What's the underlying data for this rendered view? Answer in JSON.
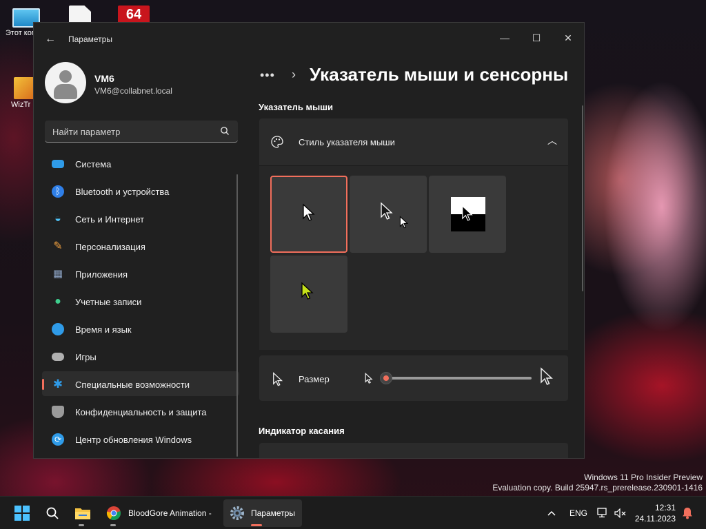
{
  "desktop": {
    "icons": [
      {
        "label": "Этот компьютер"
      },
      {
        "label": ""
      },
      {
        "label": ""
      },
      {
        "label": "WizTr"
      }
    ],
    "watermark": {
      "line1": "Windows 11 Pro Insider Preview",
      "line2": "Evaluation copy. Build 25947.rs_prerelease.230901-1416"
    }
  },
  "window": {
    "title": "Параметры",
    "controls": {
      "minimize": "—",
      "maximize": "☐",
      "close": "✕"
    }
  },
  "profile": {
    "name": "VM6",
    "email": "VM6@collabnet.local"
  },
  "search": {
    "placeholder": "Найти параметр"
  },
  "sidebar": {
    "items": [
      {
        "label": "Система",
        "icon": "system-icon",
        "color": "#2f9be8"
      },
      {
        "label": "Bluetooth и устройства",
        "icon": "bluetooth-icon",
        "color": "#2f7fe8"
      },
      {
        "label": "Сеть и Интернет",
        "icon": "wifi-icon",
        "color": "#4fc3f7"
      },
      {
        "label": "Персонализация",
        "icon": "brush-icon",
        "color": "#f0a040"
      },
      {
        "label": "Приложения",
        "icon": "apps-icon",
        "color": "#8aa0c0"
      },
      {
        "label": "Учетные записи",
        "icon": "account-icon",
        "color": "#3ecf8e"
      },
      {
        "label": "Время и язык",
        "icon": "globe-clock-icon",
        "color": "#2f9be8"
      },
      {
        "label": "Игры",
        "icon": "gamepad-icon",
        "color": "#b0b0b0"
      },
      {
        "label": "Специальные возможности",
        "icon": "accessibility-icon",
        "color": "#2f9be8",
        "active": true
      },
      {
        "label": "Конфиденциальность и защита",
        "icon": "shield-icon",
        "color": "#9a9a9a"
      },
      {
        "label": "Центр обновления Windows",
        "icon": "update-icon",
        "color": "#2f9be8"
      }
    ]
  },
  "main": {
    "breadcrumb_more": "•••",
    "title": "Указатель мыши и сенсорны",
    "section_pointer": "Указатель мыши",
    "pointer_style": {
      "label": "Стиль указателя мыши",
      "expanded": true,
      "options": [
        "white",
        "black",
        "inverted",
        "custom"
      ],
      "selected": "white",
      "custom_color": "#c6e21a"
    },
    "size": {
      "label": "Размер",
      "value": 1
    },
    "section_touch": "Индикатор касания"
  },
  "taskbar": {
    "apps": [
      {
        "name": "start-button",
        "label": ""
      },
      {
        "name": "search",
        "label": ""
      },
      {
        "name": "file-explorer",
        "label": ""
      },
      {
        "name": "chrome",
        "label": "BloodGore Animation -"
      },
      {
        "name": "settings",
        "label": "Параметры"
      }
    ],
    "tray": {
      "chevron": "^",
      "lang": "ENG",
      "time": "12:31",
      "date": "24.11.2023"
    }
  }
}
